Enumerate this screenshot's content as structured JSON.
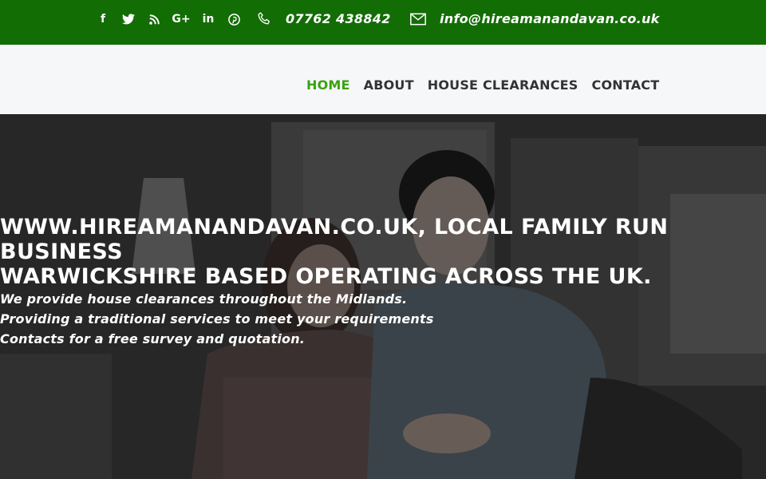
{
  "topbar": {
    "background": "#136d05",
    "social": [
      {
        "name": "facebook-icon",
        "glyph": "f"
      },
      {
        "name": "twitter-icon"
      },
      {
        "name": "rss-icon"
      },
      {
        "name": "google-plus-icon",
        "glyph": "G+"
      },
      {
        "name": "linkedin-icon",
        "glyph": "in"
      },
      {
        "name": "pinterest-icon"
      }
    ],
    "phone": "07762 438842",
    "email": "info@hireamanandavan.co.uk"
  },
  "nav": {
    "items": [
      {
        "label": "HOME",
        "active": true
      },
      {
        "label": "ABOUT",
        "active": false
      },
      {
        "label": "HOUSE CLEARANCES",
        "active": false
      },
      {
        "label": "CONTACT",
        "active": false
      }
    ],
    "active_color": "#3aa20f"
  },
  "hero": {
    "heading": "WWW.HIREAMANANDAVAN.CO.UK, LOCAL FAMILY RUN BUSINESS\nWARWICKSHIRE BASED OPERATING ACROSS THE UK.",
    "lines": [
      "We provide house clearances throughout the Midlands.",
      "Providing a traditional services to meet your requirements",
      "Contacts for a free survey and quotation."
    ]
  }
}
